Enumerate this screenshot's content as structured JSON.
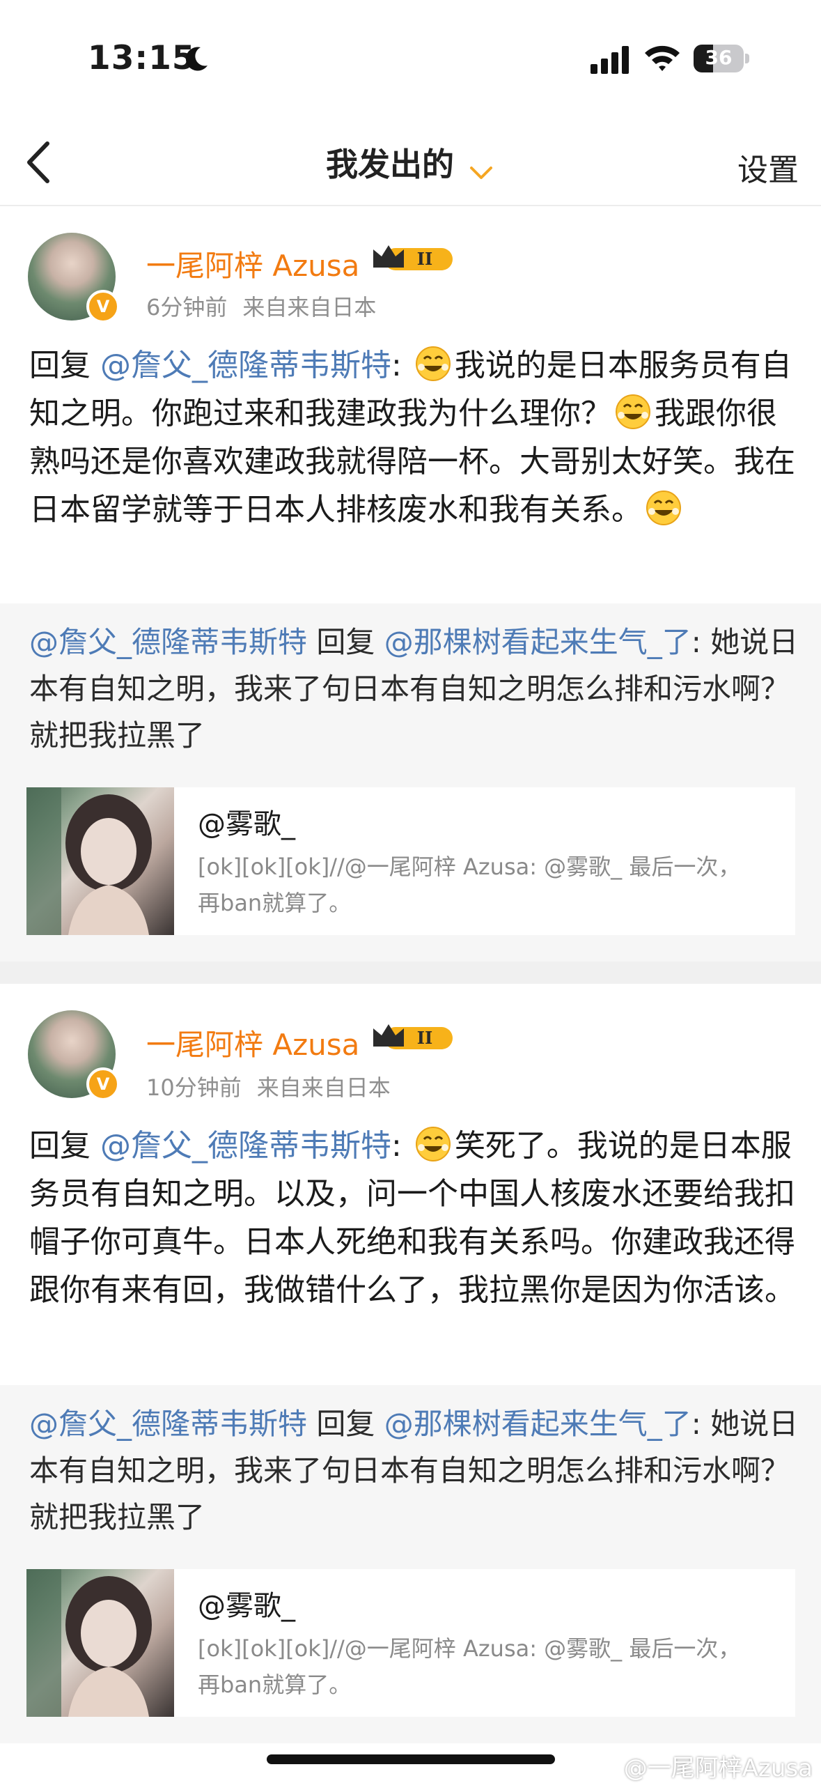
{
  "status": {
    "time": "13:15",
    "battery": "36"
  },
  "nav": {
    "title": "我发出的",
    "settings": "设置"
  },
  "colors": {
    "mention": "#4e7bb6",
    "username": "#f27b11",
    "verified": "#f6a317"
  },
  "posts": [
    {
      "username": "一尾阿梓 Azusa",
      "level_badge": "II",
      "verified_mark": "V",
      "time": "6分钟前",
      "source": "来自来自日本",
      "reply_prefix": "回复 ",
      "mention": "@詹父_德隆蒂韦斯特",
      "colon": ": ",
      "body_1": "我说的是日本服务员有自知之明。你跑过来和我建政我为什么理你？",
      "body_2": "我跟你很熟吗还是你喜欢建政我就得陪一杯。大哥别太好笑。我在日本留学就等于日本人排核废水和我有关系。",
      "quote": {
        "mention_1": "@詹父_德隆蒂韦斯特",
        "reply_word": " 回复 ",
        "mention_2": "@那棵树看起来生气_了",
        "text": ": 她说日本有自知之明，我来了句日本有自知之明怎么排和污水啊？就把我拉黑了"
      },
      "repost": {
        "user": "@雾歌_",
        "text": "[ok][ok][ok]//@一尾阿梓 Azusa: @雾歌_ 最后一次，再ban就算了。"
      }
    },
    {
      "username": "一尾阿梓 Azusa",
      "level_badge": "II",
      "verified_mark": "V",
      "time": "10分钟前",
      "source": "来自来自日本",
      "reply_prefix": "回复 ",
      "mention": "@詹父_德隆蒂韦斯特",
      "colon": ": ",
      "body_1": "笑死了。我说的是日本服务员有自知之明。以及，问一个中国人核废水还要给我扣帽子你可真牛。日本人死绝和我有关系吗。你建政我还得跟你有来有回，我做错什么了，我拉黑你是因为你活该。",
      "quote": {
        "mention_1": "@詹父_德隆蒂韦斯特",
        "reply_word": " 回复 ",
        "mention_2": "@那棵树看起来生气_了",
        "text": ": 她说日本有自知之明，我来了句日本有自知之明怎么排和污水啊？就把我拉黑了"
      },
      "repost": {
        "user": "@雾歌_",
        "text": "[ok][ok][ok]//@一尾阿梓 Azusa: @雾歌_ 最后一次，再ban就算了。"
      }
    }
  ],
  "watermark": "@一尾阿梓Azusa"
}
